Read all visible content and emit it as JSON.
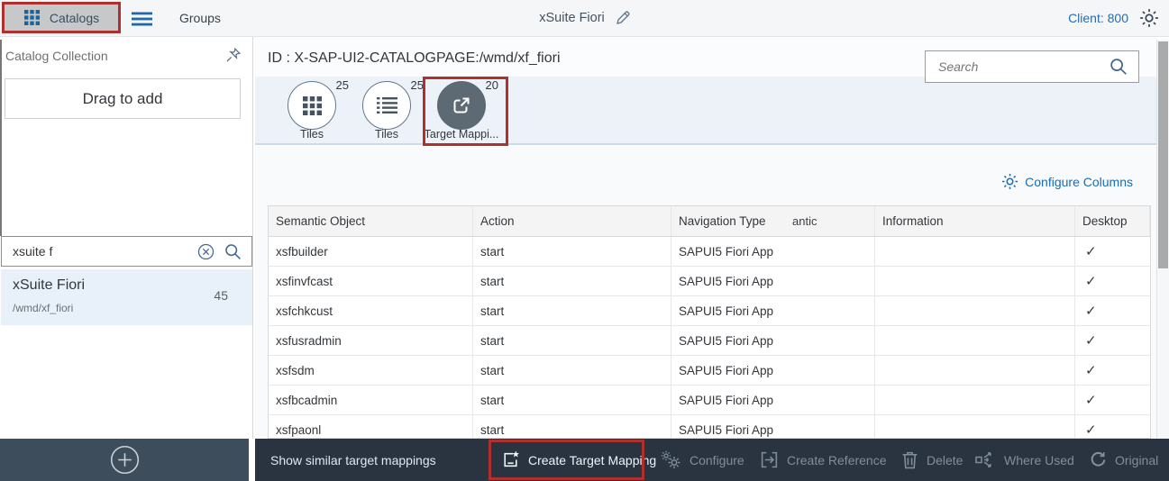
{
  "colors": {
    "accent_blue": "#1a6cb4",
    "highlight_red": "#b0302e",
    "footer_bg": "#2a3440",
    "sidebar_footer_bg": "#3e4d5b",
    "selected_item_bg": "#e8f1f9",
    "tabstrip_bg": "#edf2f8"
  },
  "topbar": {
    "catalogs_tab": "Catalogs",
    "groups_tab": "Groups",
    "title": "xSuite Fiori",
    "client": "Client: 800"
  },
  "sidebar": {
    "section_title": "Catalog Collection",
    "dropzone_label": "Drag to add",
    "search_value": "xsuite f",
    "result": {
      "title": "xSuite Fiori",
      "subtitle": "/wmd/xf_fiori",
      "count": "45"
    }
  },
  "main": {
    "page_id": "ID : X-SAP-UI2-CATALOGPAGE:/wmd/xf_fiori",
    "search_placeholder": "Search",
    "icon_tabs": [
      {
        "count": "25",
        "label": "Tiles"
      },
      {
        "count": "25",
        "label": "Tiles"
      },
      {
        "count": "20",
        "label": "Target Mappi..."
      }
    ],
    "configure_columns_label": "Configure Columns",
    "table": {
      "columns": [
        "Semantic Object",
        "Action",
        "Navigation Type",
        "Information",
        "Desktop"
      ],
      "header_artifact": "antic",
      "rows": [
        {
          "semantic_object": "xsfbuilder",
          "action": "start",
          "navigation_type": "SAPUI5 Fiori App",
          "desktop": "✓"
        },
        {
          "semantic_object": "xsfinvfcast",
          "action": "start",
          "navigation_type": "SAPUI5 Fiori App",
          "desktop": "✓"
        },
        {
          "semantic_object": "xsfchkcust",
          "action": "start",
          "navigation_type": "SAPUI5 Fiori App",
          "desktop": "✓"
        },
        {
          "semantic_object": "xsfusradmin",
          "action": "start",
          "navigation_type": "SAPUI5 Fiori App",
          "desktop": "✓"
        },
        {
          "semantic_object": "xsfsdm",
          "action": "start",
          "navigation_type": "SAPUI5 Fiori App",
          "desktop": "✓"
        },
        {
          "semantic_object": "xsfbcadmin",
          "action": "start",
          "navigation_type": "SAPUI5 Fiori App",
          "desktop": "✓"
        },
        {
          "semantic_object": "xsfpaonl",
          "action": "start",
          "navigation_type": "SAPUI5 Fiori App",
          "desktop": "✓"
        }
      ]
    }
  },
  "footer": {
    "show_similar_label": "Show similar target mappings",
    "create_target_mapping_label": "Create Target Mapping",
    "configure_label": "Configure",
    "create_reference_label": "Create Reference",
    "delete_label": "Delete",
    "where_used_label": "Where Used",
    "original_label": "Original"
  }
}
